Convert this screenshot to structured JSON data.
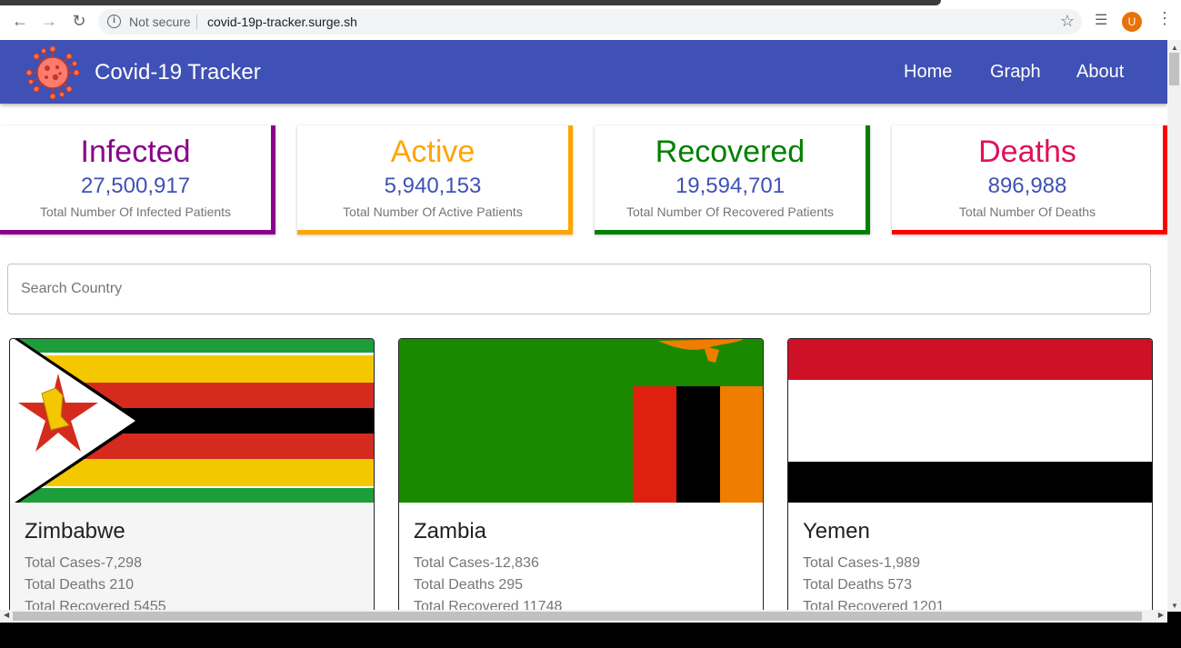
{
  "browser": {
    "security_label": "Not secure",
    "url": "covid-19p-tracker.surge.sh",
    "avatar_letter": "U"
  },
  "app": {
    "title": "Covid-19 Tracker",
    "nav": [
      "Home",
      "Graph",
      "About"
    ]
  },
  "stats": [
    {
      "label": "Infected",
      "value": "27,500,917",
      "desc": "Total Number Of Infected Patients",
      "color": "#8b008b"
    },
    {
      "label": "Active",
      "value": "5,940,153",
      "desc": "Total Number Of Active Patients",
      "color": "#ffa500"
    },
    {
      "label": "Recovered",
      "value": "19,594,701",
      "desc": "Total Number Of Recovered Patients",
      "color": "#008000"
    },
    {
      "label": "Deaths",
      "value": "896,988",
      "desc": "Total Number Of Deaths",
      "color": "#e0105a"
    }
  ],
  "search": {
    "placeholder": "Search Country"
  },
  "countries": [
    {
      "name": "Zimbabwe",
      "cases": "Total Cases-7,298",
      "deaths": "Total Deaths 210",
      "recovered": "Total Recovered 5455"
    },
    {
      "name": "Zambia",
      "cases": "Total Cases-12,836",
      "deaths": "Total Deaths 295",
      "recovered": "Total Recovered 11748"
    },
    {
      "name": "Yemen",
      "cases": "Total Cases-1,989",
      "deaths": "Total Deaths 573",
      "recovered": "Total Recovered 1201"
    }
  ],
  "colors": {
    "appbar": "#3f51b5",
    "value_text": "#3f51b5"
  }
}
